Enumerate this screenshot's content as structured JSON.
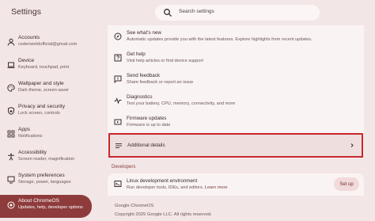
{
  "app": {
    "title": "Settings"
  },
  "search": {
    "placeholder": "Search settings"
  },
  "sidebar": {
    "items": [
      {
        "label": "Accounts",
        "sub": "coderworldofficial@gmail.com"
      },
      {
        "label": "Device",
        "sub": "Keyboard, touchpad, print"
      },
      {
        "label": "Wallpaper and style",
        "sub": "Dark theme, screen saver"
      },
      {
        "label": "Privacy and security",
        "sub": "Lock screen, controls"
      },
      {
        "label": "Apps",
        "sub": "Notifications"
      },
      {
        "label": "Accessibility",
        "sub": "Screen reader, magnification"
      },
      {
        "label": "System preferences",
        "sub": "Storage, power, languages"
      },
      {
        "label": "About ChromeOS",
        "sub": "Updates, help, developer options"
      }
    ]
  },
  "main": {
    "rows": [
      {
        "title": "See what's new",
        "sub": "Automatic updates provide you with the latest features. Explore highlights from recent updates."
      },
      {
        "title": "Get help",
        "sub": "Visit help articles or find device support"
      },
      {
        "title": "Send feedback",
        "sub": "Share feedback or report an issue"
      },
      {
        "title": "Diagnostics",
        "sub": "Test your battery, CPU, memory, connectivity, and more"
      },
      {
        "title": "Firmware updates",
        "sub": "Firmware is up to date"
      }
    ],
    "details": {
      "title": "Additional details"
    },
    "developers": {
      "heading": "Developers",
      "title": "Linux development environment",
      "sub": "Run developer tools, IDEs, and editors.",
      "link": "Learn more",
      "button": "Set up"
    },
    "copyright": "Google ChromeOS",
    "copyright2": "Copyright 2025 Google LLC. All rights reserved."
  },
  "colors": {
    "accent": "#8d3b3b",
    "highlight_border": "#c8262b",
    "background": "#f3e6e6"
  }
}
